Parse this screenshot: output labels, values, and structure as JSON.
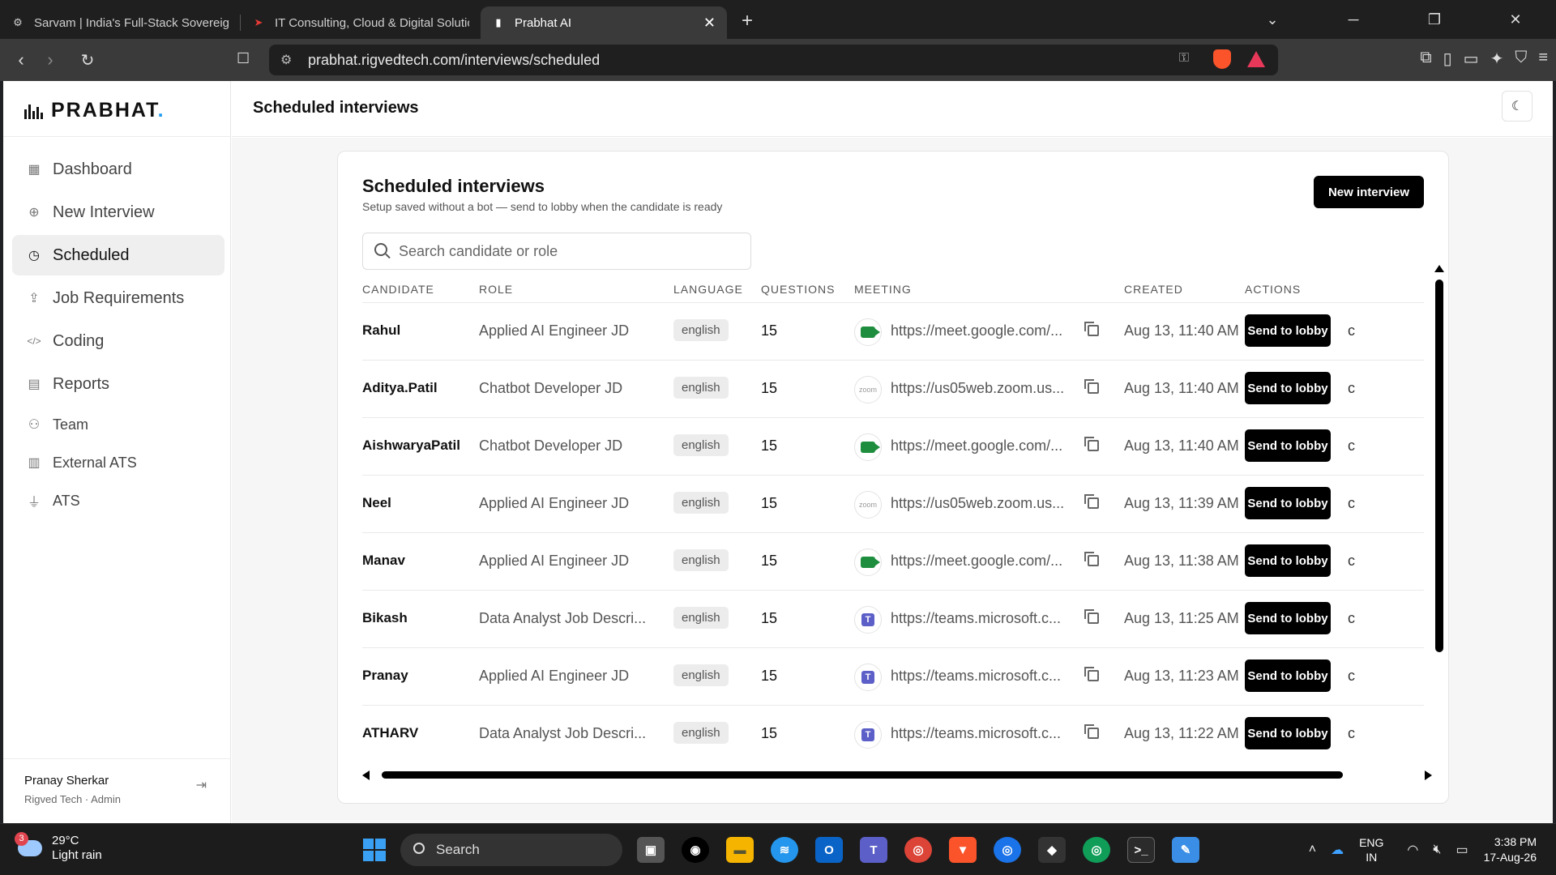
{
  "browser": {
    "tabs": [
      {
        "title": "Sarvam | India's Full-Stack Sovereign",
        "icon": "sarvam-icon"
      },
      {
        "title": "IT Consulting, Cloud & Digital Solutio",
        "icon": "rigved-icon"
      },
      {
        "title": "Prabhat AI",
        "icon": "prabhat-icon"
      }
    ],
    "url": "prabhat.rigvedtech.com/interviews/scheduled"
  },
  "app": {
    "brand": "PRABHAT",
    "brand_dot": ".",
    "accent_color": "#1d9bf0",
    "header_title": "Scheduled interviews"
  },
  "sidebar": {
    "items": [
      {
        "label": "Dashboard",
        "icon": "grid-icon"
      },
      {
        "label": "New Interview",
        "icon": "plus-circle-icon"
      },
      {
        "label": "Scheduled",
        "icon": "calendar-clock-icon",
        "active": true
      },
      {
        "label": "Job Requirements",
        "icon": "upload-icon"
      },
      {
        "label": "Coding",
        "icon": "code-icon"
      },
      {
        "label": "Reports",
        "icon": "document-icon"
      },
      {
        "label": "Team",
        "icon": "users-icon"
      },
      {
        "label": "External ATS",
        "icon": "briefcase-icon"
      },
      {
        "label": "ATS",
        "icon": "plug-icon"
      }
    ],
    "user": {
      "name": "Pranay Sherkar",
      "role": "Rigved Tech · Admin"
    }
  },
  "main": {
    "title": "Scheduled interviews",
    "subtitle": "Setup saved without a bot — send to lobby when the candidate is ready",
    "new_button": "New interview",
    "search_placeholder": "Search candidate or role",
    "columns": [
      "CANDIDATE",
      "ROLE",
      "LANGUAGE",
      "QUESTIONS",
      "MEETING",
      "CREATED",
      "ACTIONS"
    ],
    "action_label": "Send to lobby",
    "rows": [
      {
        "candidate": "Rahul",
        "role": "Applied AI Engineer JD",
        "language": "english",
        "questions": "15",
        "meeting_icon": "google-meet-icon",
        "meeting": "https://meet.google.com/...",
        "created": "Aug 13, 11:40 AM"
      },
      {
        "candidate": "Aditya.Patil",
        "role": "Chatbot Developer JD",
        "language": "english",
        "questions": "15",
        "meeting_icon": "zoom-icon",
        "meeting": "https://us05web.zoom.us...",
        "created": "Aug 13, 11:40 AM"
      },
      {
        "candidate": "AishwaryaPatil",
        "role": "Chatbot Developer JD",
        "language": "english",
        "questions": "15",
        "meeting_icon": "google-meet-icon",
        "meeting": "https://meet.google.com/...",
        "created": "Aug 13, 11:40 AM"
      },
      {
        "candidate": "Neel",
        "role": "Applied AI Engineer JD",
        "language": "english",
        "questions": "15",
        "meeting_icon": "zoom-icon",
        "meeting": "https://us05web.zoom.us...",
        "created": "Aug 13, 11:39 AM"
      },
      {
        "candidate": "Manav",
        "role": "Applied AI Engineer JD",
        "language": "english",
        "questions": "15",
        "meeting_icon": "google-meet-icon",
        "meeting": "https://meet.google.com/...",
        "created": "Aug 13, 11:38 AM"
      },
      {
        "candidate": "Bikash",
        "role": "Data Analyst Job Descri...",
        "language": "english",
        "questions": "15",
        "meeting_icon": "teams-icon",
        "meeting": "https://teams.microsoft.c...",
        "created": "Aug 13, 11:25 AM"
      },
      {
        "candidate": "Pranay",
        "role": "Applied AI Engineer JD",
        "language": "english",
        "questions": "15",
        "meeting_icon": "teams-icon",
        "meeting": "https://teams.microsoft.c...",
        "created": "Aug 13, 11:23 AM"
      },
      {
        "candidate": "ATHARV",
        "role": "Data Analyst Job Descri...",
        "language": "english",
        "questions": "15",
        "meeting_icon": "teams-icon",
        "meeting": "https://teams.microsoft.c...",
        "created": "Aug 13, 11:22 AM"
      }
    ]
  },
  "taskbar": {
    "weather_badge": "3",
    "temperature": "29°C",
    "weather": "Light rain",
    "search": "Search",
    "apps": [
      "task-view-icon",
      "github-icon",
      "file-explorer-icon",
      "docker-icon",
      "outlook-icon",
      "teams-icon",
      "chrome-icon",
      "brave-icon",
      "chrome-dev-icon",
      "cube-icon",
      "chrome-canary-icon",
      "terminal-icon",
      "paint-icon"
    ],
    "lang": "ENG",
    "region": "IN",
    "time": "3:38 PM",
    "date": "17-Aug-26"
  }
}
